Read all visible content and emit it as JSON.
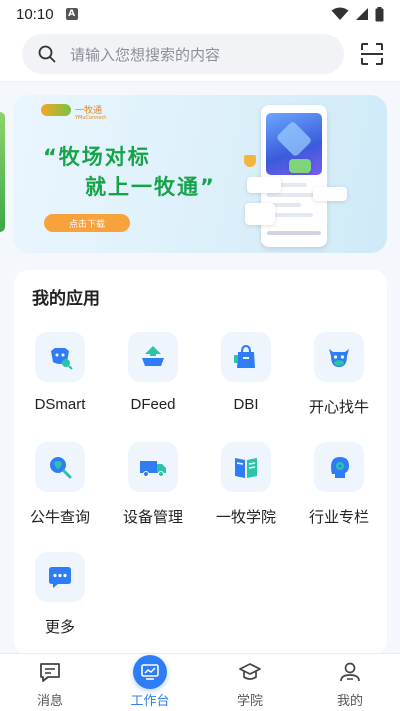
{
  "status_bar": {
    "time": "10:10",
    "indicator": "A"
  },
  "search": {
    "placeholder": "请输入您想搜索的内容"
  },
  "banner": {
    "logo_text": "一牧通",
    "logo_sub": "YMuConnect",
    "line1": "“牧场对标",
    "line2": "就上一牧通”",
    "download_label": "点击下载"
  },
  "apps": {
    "title": "我的应用",
    "items": [
      {
        "label": "DSmart",
        "icon": "cow-search-icon"
      },
      {
        "label": "DFeed",
        "icon": "feed-trough-icon"
      },
      {
        "label": "DBI",
        "icon": "shopping-bag-icon"
      },
      {
        "label": "开心找牛",
        "icon": "cow-face-icon"
      },
      {
        "label": "公牛查询",
        "icon": "bull-search-icon"
      },
      {
        "label": "设备管理",
        "icon": "truck-icon"
      },
      {
        "label": "一牧学院",
        "icon": "book-icon"
      },
      {
        "label": "行业专栏",
        "icon": "head-gear-icon"
      },
      {
        "label": "更多",
        "icon": "more-dots-icon"
      }
    ]
  },
  "tabs": [
    {
      "label": "消息",
      "icon": "message-icon",
      "active": false
    },
    {
      "label": "工作台",
      "icon": "workbench-icon",
      "active": true
    },
    {
      "label": "学院",
      "icon": "graduation-cap-icon",
      "active": false
    },
    {
      "label": "我的",
      "icon": "user-icon",
      "active": false
    }
  ],
  "colors": {
    "accent": "#2f7df6",
    "banner_green": "#16a34a",
    "download_orange": "#f7a23b",
    "icon_blue": "#2f7df6",
    "icon_teal": "#2bc4a8"
  }
}
